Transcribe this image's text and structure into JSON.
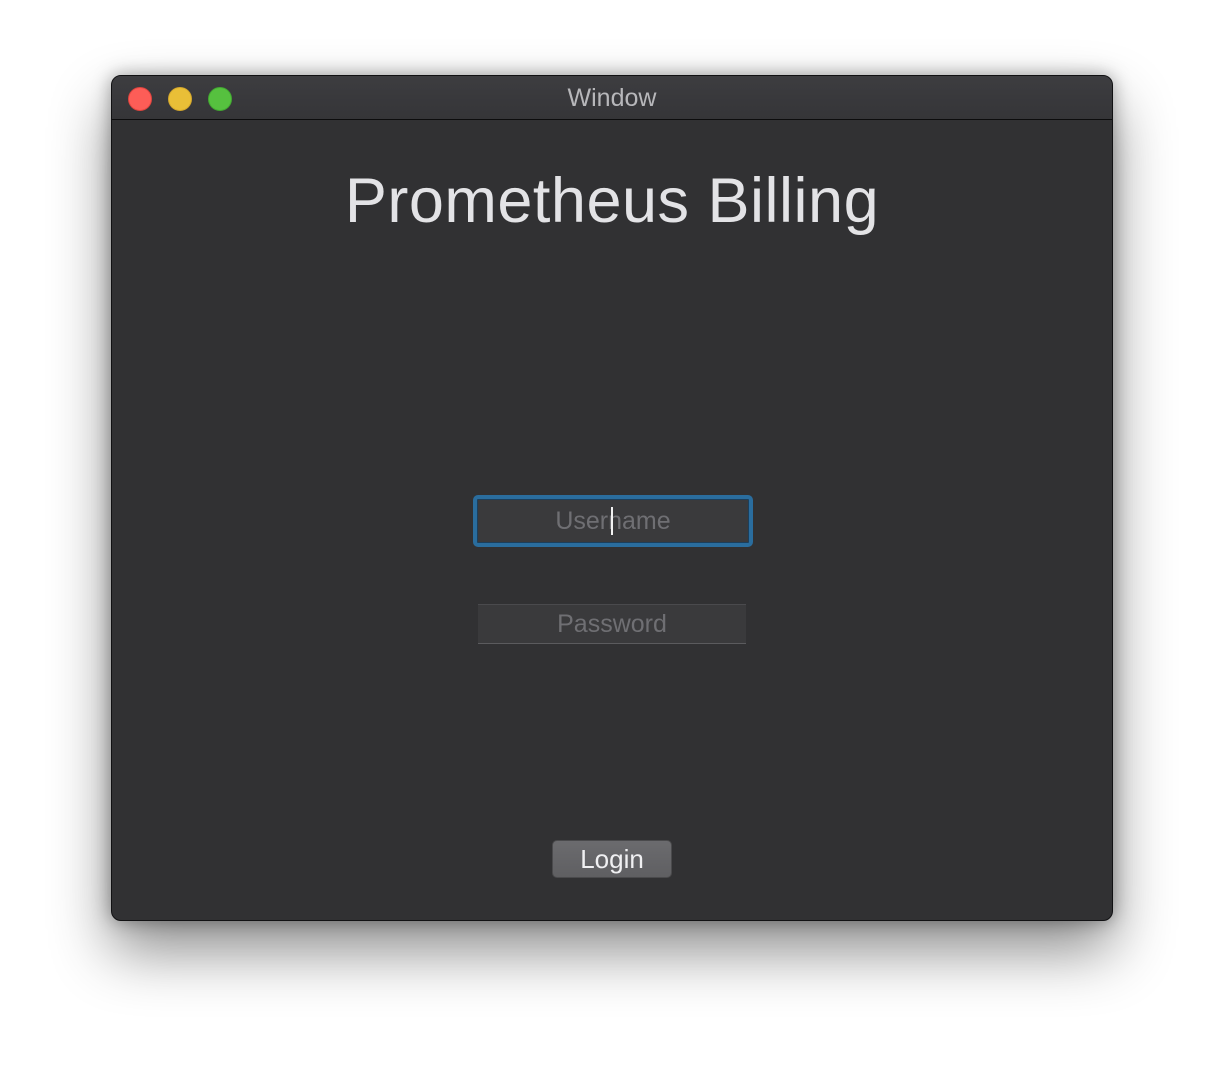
{
  "window": {
    "title": "Window"
  },
  "app": {
    "title": "Prometheus Billing"
  },
  "form": {
    "username": {
      "placeholder": "Username",
      "value": "",
      "focused": true
    },
    "password": {
      "placeholder": "Password",
      "value": ""
    },
    "login_label": "Login"
  },
  "colors": {
    "window_bg": "#313133",
    "focus_ring": "#2a6d9e",
    "close": "#fd5d57",
    "minimize": "#e9bf37",
    "zoom": "#56c13f"
  },
  "icons": {
    "close": "close-traffic-light-icon",
    "minimize": "minimize-traffic-light-icon",
    "zoom": "zoom-traffic-light-icon"
  }
}
